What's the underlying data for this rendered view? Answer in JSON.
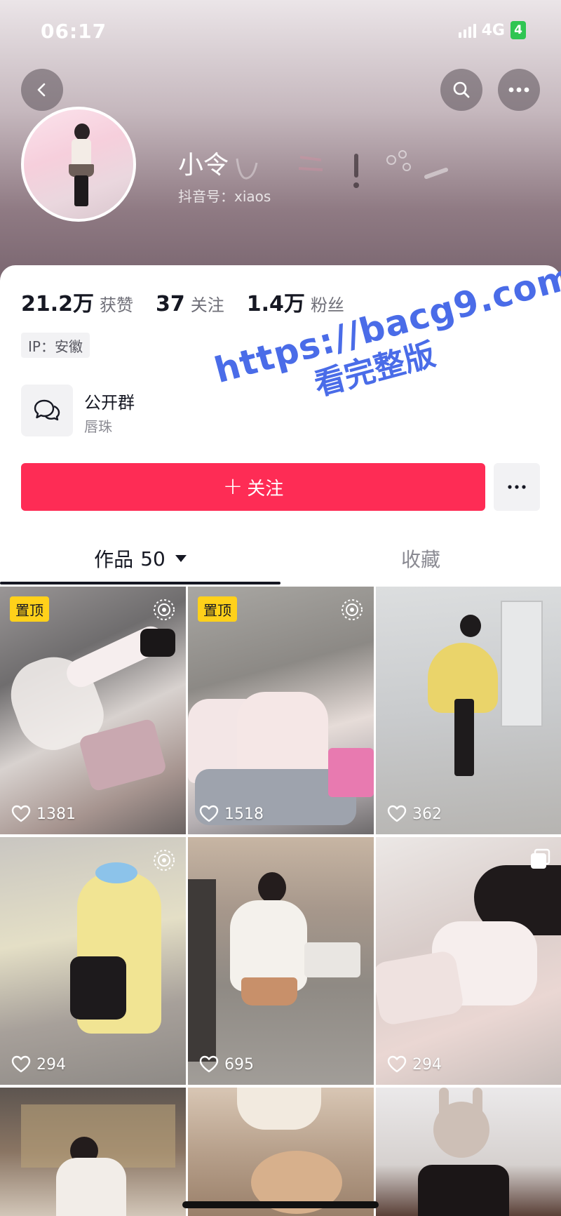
{
  "status_bar": {
    "time": "06:17",
    "network": "4G",
    "battery": "4"
  },
  "profile": {
    "username": "小令",
    "douyin_id_label": "抖音号：",
    "douyin_id": "xiaos"
  },
  "stats": [
    {
      "number": "21.2万",
      "label": "获赞"
    },
    {
      "number": "37",
      "label": "关注"
    },
    {
      "number": "1.4万",
      "label": "粉丝"
    }
  ],
  "ip": "IP：安徽",
  "group": {
    "title": "公开群",
    "subtitle": "唇珠"
  },
  "follow_button": {
    "plus": "+",
    "label": "关注"
  },
  "tabs": {
    "works_label": "作品",
    "works_count": "50",
    "likes_label": "收藏"
  },
  "grid": [
    {
      "likes": "1381",
      "pinned": true,
      "pin_label": "置顶",
      "live": true
    },
    {
      "likes": "1518",
      "pinned": true,
      "pin_label": "置顶",
      "live": true
    },
    {
      "likes": "362",
      "pinned": false
    },
    {
      "likes": "294",
      "pinned": false,
      "live": true
    },
    {
      "likes": "695",
      "pinned": false
    },
    {
      "likes": "294",
      "pinned": false,
      "multi": true
    },
    {
      "likes": "",
      "pinned": false
    },
    {
      "likes": "",
      "pinned": false
    },
    {
      "likes": "",
      "pinned": false
    }
  ],
  "watermark": {
    "line1": "https://bacg9.com",
    "line2": "看完整版"
  },
  "colors": {
    "accent": "#fe2c55",
    "pin_badge": "#ffd11a",
    "watermark": "#4a6ce8"
  },
  "icons": [
    "back-icon",
    "search-icon",
    "more-icon",
    "chat-group-icon",
    "heart-icon",
    "live-icon",
    "multi-image-icon",
    "caret-down-icon"
  ]
}
